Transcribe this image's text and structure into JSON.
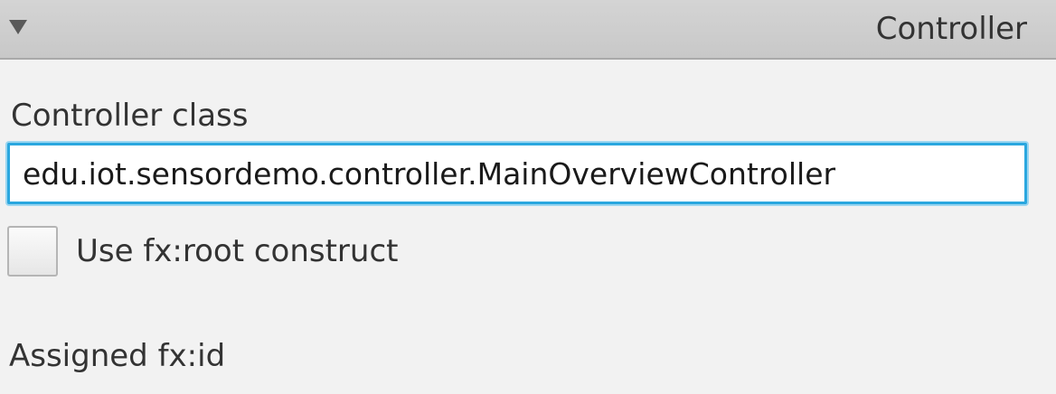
{
  "header": {
    "title": "Controller",
    "collapse_icon": "triangle-down-icon"
  },
  "controller_class": {
    "label": "Controller class",
    "value": "edu.iot.sensordemo.controller.MainOverviewController",
    "focus_color": "#2aa7df"
  },
  "fx_root": {
    "label": "Use fx:root construct",
    "checked": false
  },
  "assigned_fx_id": {
    "label": "Assigned fx:id"
  }
}
